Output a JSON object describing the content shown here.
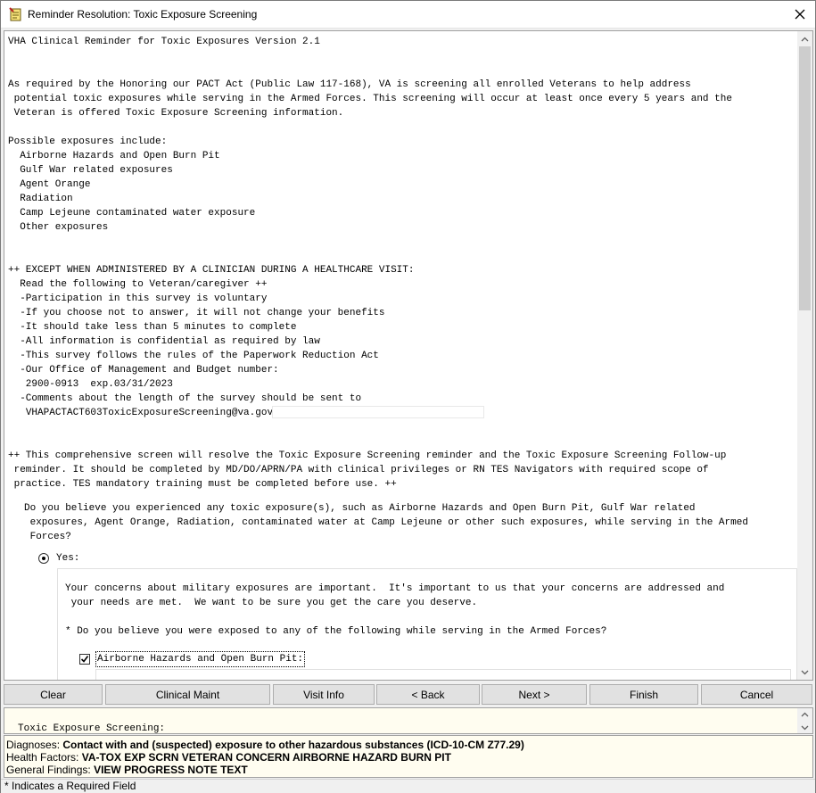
{
  "window": {
    "title": "Reminder Resolution: Toxic Exposure Screening",
    "close_glyph": "✕"
  },
  "content": {
    "lines": [
      "VHA Clinical Reminder for Toxic Exposures Version 2.1",
      "",
      "",
      "As required by the Honoring our PACT Act (Public Law 117-168), VA is screening all enrolled Veterans to help address",
      " potential toxic exposures while serving in the Armed Forces. This screening will occur at least once every 5 years and the",
      " Veteran is offered Toxic Exposure Screening information.",
      "",
      "Possible exposures include:",
      "  Airborne Hazards and Open Burn Pit",
      "  Gulf War related exposures",
      "  Agent Orange",
      "  Radiation",
      "  Camp Lejeune contaminated water exposure",
      "  Other exposures",
      "",
      "",
      "++ EXCEPT WHEN ADMINISTERED BY A CLINICIAN DURING A HEALTHCARE VISIT:",
      "  Read the following to Veteran/caregiver ++",
      "  -Participation in this survey is voluntary",
      "  -If you choose not to answer, it will not change your benefits",
      "  -It should take less than 5 minutes to complete",
      "  -All information is confidential as required by law",
      "  -This survey follows the rules of the Paperwork Reduction Act",
      "  -Our Office of Management and Budget number:",
      "   2900-0913  exp.03/31/2023",
      "  -Comments about the length of the survey should be sent to"
    ],
    "email": "VHAPACTACT603ToxicExposureScreening@va.gov",
    "lines2": [
      "",
      "",
      "++ This comprehensive screen will resolve the Toxic Exposure Screening reminder and the Toxic Exposure Screening Follow-up",
      " reminder. It should be completed by MD/DO/APRN/PA with clinical privileges or RN TES Navigators with required scope of",
      " practice. TES mandatory training must be completed before use. ++"
    ],
    "question": [
      "Do you believe you experienced any toxic exposure(s), such as Airborne Hazards and Open Burn Pit, Gulf War related",
      " exposures, Agent Orange, Radiation, contaminated water at Camp Lejeune or other such exposures, while serving in the Armed",
      " Forces?"
    ],
    "yes_label": "Yes:",
    "sub_text": [
      "Your concerns about military exposures are important.  It's important to us that your concerns are addressed and",
      " your needs are met.  We want to be sure you get the care you deserve.",
      "",
      "* Do you believe you were exposed to any of the following while serving in the Armed Forces?"
    ],
    "airborne_label": "Airborne Hazards and Open Burn Pit:"
  },
  "buttons": {
    "clear": "Clear",
    "clinical_maint": "Clinical Maint",
    "visit_info": "Visit Info",
    "back": "< Back",
    "next": "Next >",
    "finish": "Finish",
    "cancel": "Cancel"
  },
  "preview": {
    "text": "Toxic Exposure Screening:"
  },
  "info": {
    "diagnoses_label": "Diagnoses:",
    "diagnoses_value": "Contact with and (suspected) exposure to other hazardous substances (ICD-10-CM Z77.29)",
    "health_factors_label": "Health Factors:",
    "health_factors_value": "VA-TOX EXP SCRN VETERAN CONCERN AIRBORNE HAZARD BURN PIT",
    "general_findings_label": "General Findings:",
    "general_findings_value": "VIEW PROGRESS NOTE TEXT"
  },
  "status": {
    "text": "* Indicates a Required Field"
  }
}
